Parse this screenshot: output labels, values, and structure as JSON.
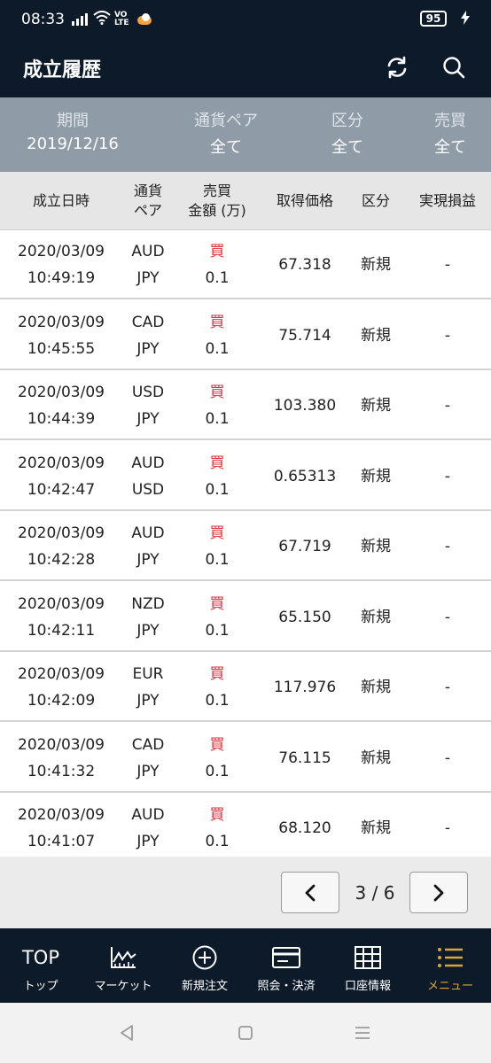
{
  "status_bar": {
    "time": "08:33",
    "network": "VO LTE",
    "battery": "95"
  },
  "header": {
    "title": "成立履歴"
  },
  "filters": [
    {
      "label": "期間",
      "value": "2019/12/16"
    },
    {
      "label": "通貨ペア",
      "value": "全て"
    },
    {
      "label": "区分",
      "value": "全て"
    },
    {
      "label": "売買",
      "value": "全て"
    }
  ],
  "columns": {
    "datetime": "成立日時",
    "pair_1": "通貨",
    "pair_2": "ペア",
    "trade_1": "売買",
    "trade_2": "金額 (万)",
    "price": "取得価格",
    "type": "区分",
    "pl": "実現損益"
  },
  "rows": [
    {
      "date": "2020/03/09",
      "time": "10:49:19",
      "base": "AUD",
      "quote": "JPY",
      "side": "買",
      "amount": "0.1",
      "price": "67.318",
      "type": "新規",
      "pl": "-"
    },
    {
      "date": "2020/03/09",
      "time": "10:45:55",
      "base": "CAD",
      "quote": "JPY",
      "side": "買",
      "amount": "0.1",
      "price": "75.714",
      "type": "新規",
      "pl": "-"
    },
    {
      "date": "2020/03/09",
      "time": "10:44:39",
      "base": "USD",
      "quote": "JPY",
      "side": "買",
      "amount": "0.1",
      "price": "103.380",
      "type": "新規",
      "pl": "-"
    },
    {
      "date": "2020/03/09",
      "time": "10:42:47",
      "base": "AUD",
      "quote": "USD",
      "side": "買",
      "amount": "0.1",
      "price": "0.65313",
      "type": "新規",
      "pl": "-"
    },
    {
      "date": "2020/03/09",
      "time": "10:42:28",
      "base": "AUD",
      "quote": "JPY",
      "side": "買",
      "amount": "0.1",
      "price": "67.719",
      "type": "新規",
      "pl": "-"
    },
    {
      "date": "2020/03/09",
      "time": "10:42:11",
      "base": "NZD",
      "quote": "JPY",
      "side": "買",
      "amount": "0.1",
      "price": "65.150",
      "type": "新規",
      "pl": "-"
    },
    {
      "date": "2020/03/09",
      "time": "10:42:09",
      "base": "EUR",
      "quote": "JPY",
      "side": "買",
      "amount": "0.1",
      "price": "117.976",
      "type": "新規",
      "pl": "-"
    },
    {
      "date": "2020/03/09",
      "time": "10:41:32",
      "base": "CAD",
      "quote": "JPY",
      "side": "買",
      "amount": "0.1",
      "price": "76.115",
      "type": "新規",
      "pl": "-"
    },
    {
      "date": "2020/03/09",
      "time": "10:41:07",
      "base": "AUD",
      "quote": "JPY",
      "side": "買",
      "amount": "0.1",
      "price": "68.120",
      "type": "新規",
      "pl": "-"
    }
  ],
  "pagination": {
    "current": "3",
    "total": "6",
    "text": "3 / 6"
  },
  "bottom_nav": [
    {
      "label": "トップ",
      "icon": "top-text-icon",
      "top_text": "TOP"
    },
    {
      "label": "マーケット",
      "icon": "chart-line-icon"
    },
    {
      "label": "新規注文",
      "icon": "plus-circle-icon"
    },
    {
      "label": "照会・決済",
      "icon": "card-icon"
    },
    {
      "label": "口座情報",
      "icon": "grid-icon"
    },
    {
      "label": "メニュー",
      "icon": "list-menu-icon"
    }
  ],
  "colors": {
    "header_bg": "#0d1a2a",
    "filter_bg": "#8f9ca8",
    "buy": "#e0303c",
    "active_nav": "#d8a63a"
  }
}
